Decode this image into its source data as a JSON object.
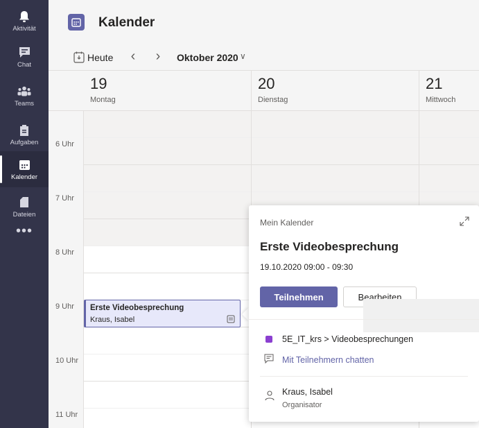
{
  "rail": {
    "items": [
      {
        "label": "Aktivität",
        "icon": "bell-icon"
      },
      {
        "label": "Chat",
        "icon": "chat-icon"
      },
      {
        "label": "Teams",
        "icon": "teams-icon"
      },
      {
        "label": "Aufgaben",
        "icon": "assignments-icon"
      },
      {
        "label": "Kalender",
        "icon": "calendar-icon",
        "active": true
      },
      {
        "label": "Dateien",
        "icon": "files-icon"
      }
    ],
    "more": "•••"
  },
  "header": {
    "title": "Kalender"
  },
  "toolbar": {
    "today_label": "Heute",
    "prev": "‹",
    "next": "›",
    "month": "Oktober 2020",
    "chevron": "∨"
  },
  "days": [
    {
      "num": "19",
      "name": "Montag"
    },
    {
      "num": "20",
      "name": "Dienstag"
    },
    {
      "num": "21",
      "name": "Mittwoch"
    }
  ],
  "times": [
    "6 Uhr",
    "7 Uhr",
    "8 Uhr",
    "9 Uhr",
    "10 Uhr",
    "11 Uhr"
  ],
  "event": {
    "title": "Erste Videobesprechung",
    "organizer": "Kraus, Isabel"
  },
  "popup": {
    "calendar": "Mein Kalender",
    "title": "Erste Videobesprechung",
    "time": "19.10.2020 09:00 - 09:30",
    "join": "Teilnehmen",
    "edit": "Bearbeiten",
    "channel": "5E_IT_krs > Videobesprechungen",
    "chat": "Mit Teilnehmern chatten",
    "organizer_name": "Kraus, Isabel",
    "organizer_role": "Organisator"
  },
  "colors": {
    "rail_bg": "#33344a",
    "accent": "#6264a7",
    "event_bg": "#e7e8fa",
    "channel": "#8b3fd0"
  }
}
